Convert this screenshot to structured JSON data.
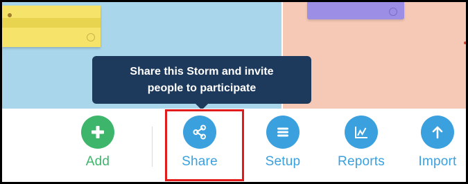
{
  "tooltip": {
    "line1": "Share this Storm and invite",
    "line2": "people to participate"
  },
  "toolbar": {
    "items": [
      {
        "label": "Add",
        "icon": "plus-icon",
        "color": "#3db66c"
      },
      {
        "label": "Share",
        "icon": "share-icon",
        "color": "#3aa0de"
      },
      {
        "label": "Setup",
        "icon": "menu-lines-icon",
        "color": "#3aa0de"
      },
      {
        "label": "Reports",
        "icon": "chart-icon",
        "color": "#3aa0de"
      },
      {
        "label": "Import",
        "icon": "arrow-up-icon",
        "color": "#3aa0de"
      }
    ]
  },
  "colors": {
    "canvas_blue": "#a9d6ea",
    "canvas_peach": "#f6c9b6",
    "tooltip_bg": "#1d3a5c",
    "highlight": "#e31a1a"
  }
}
